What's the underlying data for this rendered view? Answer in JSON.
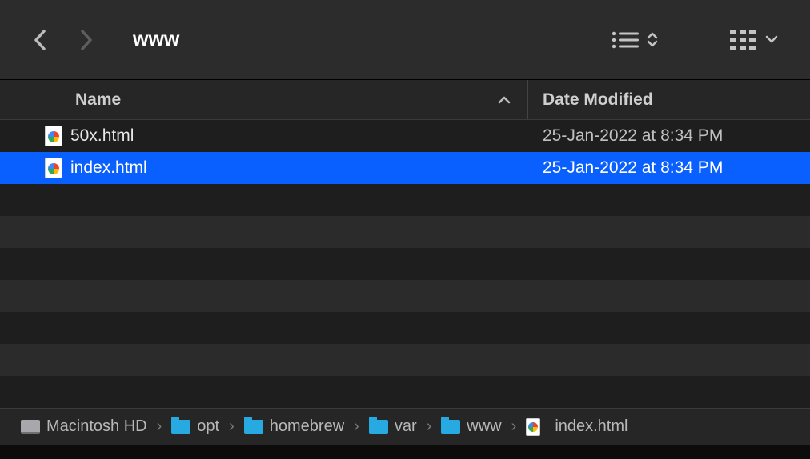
{
  "toolbar": {
    "title": "www"
  },
  "columns": {
    "name": "Name",
    "date": "Date Modified"
  },
  "files": [
    {
      "name": "50x.html",
      "date": "25-Jan-2022 at 8:34 PM",
      "selected": false
    },
    {
      "name": "index.html",
      "date": "25-Jan-2022 at 8:34 PM",
      "selected": true
    }
  ],
  "path": [
    {
      "label": "Macintosh HD",
      "icon": "hd"
    },
    {
      "label": "opt",
      "icon": "folder"
    },
    {
      "label": "homebrew",
      "icon": "folder"
    },
    {
      "label": "var",
      "icon": "folder"
    },
    {
      "label": "www",
      "icon": "folder"
    },
    {
      "label": "index.html",
      "icon": "file"
    }
  ]
}
